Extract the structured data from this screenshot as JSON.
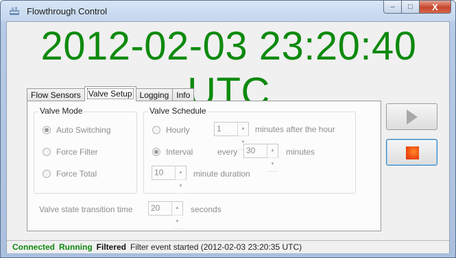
{
  "window": {
    "title": "Flowthrough Control",
    "caption_buttons": {
      "minimize": "–",
      "maximize": "□",
      "close": "X"
    }
  },
  "clock": {
    "text": "2012-02-03 23:20:40 UTC",
    "color": "#0e8a0e"
  },
  "tabs": [
    {
      "label": "Flow Sensors",
      "active": false
    },
    {
      "label": "Valve Setup",
      "active": true
    },
    {
      "label": "Logging",
      "active": false
    },
    {
      "label": "Info",
      "active": false
    }
  ],
  "valve_mode": {
    "title": "Valve Mode",
    "options": [
      {
        "label": "Auto Switching",
        "checked": true
      },
      {
        "label": "Force Filter",
        "checked": false
      },
      {
        "label": "Force Total",
        "checked": false
      }
    ]
  },
  "valve_schedule": {
    "title": "Valve Schedule",
    "hourly": {
      "label": "Hourly",
      "checked": false,
      "value": "1",
      "suffix": "minutes after the hour"
    },
    "interval": {
      "label": "Interval",
      "checked": true,
      "prefix": "every",
      "value": "30",
      "suffix": "minutes"
    },
    "duration": {
      "value": "10",
      "suffix": "minute duration"
    }
  },
  "transition": {
    "label": "Valve state transition time",
    "value": "20",
    "suffix": "seconds"
  },
  "buttons": {
    "start_icon": "play-icon",
    "stop_icon": "stop-icon",
    "stop_color": "#f04b10"
  },
  "status": {
    "connected": "Connected",
    "running": "Running",
    "mode": "Filtered",
    "message": "Filter event started (2012-02-03 23:20:35 UTC)",
    "accent_color": "#0f8a0f"
  }
}
